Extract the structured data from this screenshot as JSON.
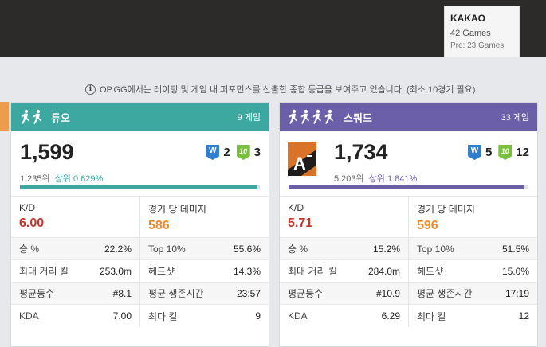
{
  "server": {
    "name": "KAKAO",
    "games": "42 Games",
    "pre": "Pre: 23 Games"
  },
  "info_text": "OP.GG에서는 레이팅 및 게임 내 퍼포먼스를 산출한 종합 등급을 보여주고 있습니다. (최소 10경기 필요)",
  "colors": {
    "duo": "#3ca89f",
    "squad": "#6a5fa8",
    "kd": "#c0392b",
    "damage": "#ee8a2c"
  },
  "duo": {
    "mode": "듀오",
    "games": "9 게임",
    "rating": "1,599",
    "rank": "1,235위",
    "top": "상위 0.629%",
    "progress": 0.99,
    "wins": "2",
    "top10": "3",
    "kd_label": "K/D",
    "kd": "6.00",
    "dmg_label": "경기 당 데미지",
    "dmg": "586",
    "left_stats": [
      {
        "label": "승 %",
        "value": "22.2%"
      },
      {
        "label": "최대 거리 킬",
        "value": "253.0m"
      },
      {
        "label": "평균등수",
        "value": "#8.1"
      },
      {
        "label": "KDA",
        "value": "7.00"
      }
    ],
    "right_stats": [
      {
        "label": "Top 10%",
        "value": "55.6%"
      },
      {
        "label": "헤드샷",
        "value": "14.3%"
      },
      {
        "label": "평균 생존시간",
        "value": "23:57"
      },
      {
        "label": "최다 킬",
        "value": "9"
      }
    ]
  },
  "squad": {
    "mode": "스쿼드",
    "games": "33 게임",
    "rating": "1,734",
    "rank": "5,203위",
    "top": "상위 1.841%",
    "progress": 0.98,
    "tier": "A",
    "wins": "5",
    "top10": "12",
    "kd_label": "K/D",
    "kd": "5.71",
    "dmg_label": "경기 당 데미지",
    "dmg": "596",
    "left_stats": [
      {
        "label": "승 %",
        "value": "15.2%"
      },
      {
        "label": "최대 거리 킬",
        "value": "284.0m"
      },
      {
        "label": "평균등수",
        "value": "#10.9"
      },
      {
        "label": "KDA",
        "value": "6.29"
      }
    ],
    "right_stats": [
      {
        "label": "Top 10%",
        "value": "51.5%"
      },
      {
        "label": "헤드샷",
        "value": "15.0%"
      },
      {
        "label": "평균 생존시간",
        "value": "17:19"
      },
      {
        "label": "최다 킬",
        "value": "12"
      }
    ]
  },
  "badges": {
    "win": "W",
    "top10": "10"
  },
  "icons": {
    "info": "info-icon",
    "duo": "running-players-icon",
    "squad": "running-players-icon"
  }
}
